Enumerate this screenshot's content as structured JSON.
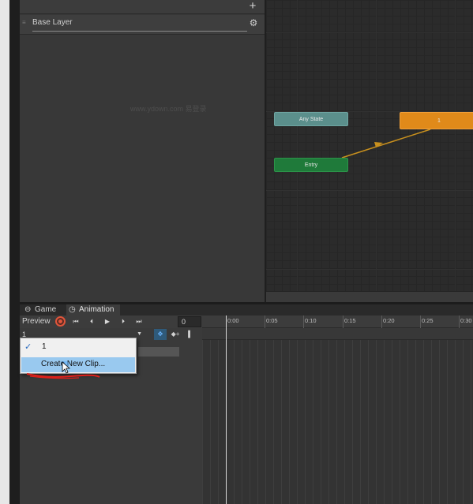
{
  "layers": {
    "add_label": "+",
    "base_layer": "Base Layer",
    "gear_glyph": "⚙",
    "handle_glyph": "≡",
    "watermark": "www.ydown.com 易登录"
  },
  "graph": {
    "states": [
      {
        "id": "any",
        "label": "Any State",
        "color": "#5b8f8c"
      },
      {
        "id": "entry",
        "label": "Entry",
        "color": "#1f7a3a"
      },
      {
        "id": "state1",
        "label": "1",
        "color": "#e08a1a"
      }
    ],
    "transition_color": "#c8901e"
  },
  "animation": {
    "tabs": [
      {
        "label": "Game",
        "icon": "gamepad-icon",
        "glyph": "⊖"
      },
      {
        "label": "Animation",
        "icon": "clock-icon",
        "glyph": "◷"
      }
    ],
    "toolbar": {
      "preview_label": "Preview",
      "first_glyph": "⏮",
      "prev_glyph": "⏴",
      "play_glyph": "▶",
      "next_glyph": "⏵",
      "last_glyph": "⏭",
      "frame_value": "0",
      "record_color": "#e0553b"
    },
    "clip_select_value": "1",
    "clip_arrow": "▼",
    "keyframe_tools": {
      "filter_glyph": "✥",
      "add_key_glyph": "◆+",
      "event_glyph": "▌"
    },
    "ruler_labels": [
      "0:00",
      "0:05",
      "0:10",
      "0:15",
      "0:20",
      "0:25",
      "0:30"
    ]
  },
  "dropdown": {
    "options": [
      {
        "label": "1",
        "checked": true,
        "check_glyph": "✓"
      },
      {
        "label": "Create New Clip...",
        "highlighted": true
      }
    ],
    "highlight_color": "#99c9ef"
  }
}
